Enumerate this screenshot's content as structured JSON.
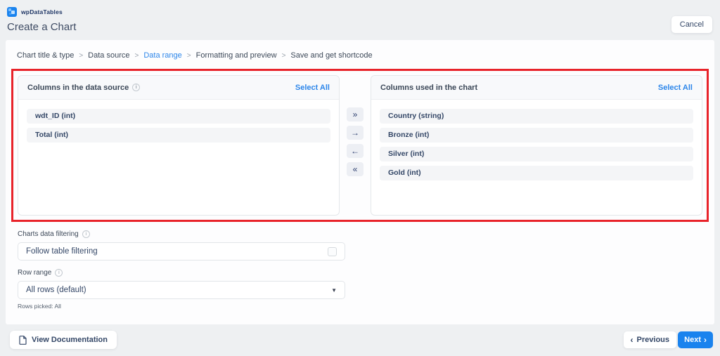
{
  "brand": {
    "name": "wpDataTables"
  },
  "page": {
    "title": "Create a Chart"
  },
  "header": {
    "cancel_label": "Cancel"
  },
  "breadcrumb": {
    "separator": ">",
    "steps": [
      {
        "label": "Chart title & type",
        "active": false
      },
      {
        "label": "Data source",
        "active": false
      },
      {
        "label": "Data range",
        "active": true
      },
      {
        "label": "Formatting and preview",
        "active": false
      },
      {
        "label": "Save and get shortcode",
        "active": false
      }
    ]
  },
  "columns_transfer": {
    "source_panel": {
      "title": "Columns in the data source",
      "select_all_label": "Select All",
      "items": [
        {
          "label": "wdt_ID (int)"
        },
        {
          "label": "Total (int)"
        }
      ]
    },
    "chart_panel": {
      "title": "Columns used in the chart",
      "select_all_label": "Select All",
      "items": [
        {
          "label": "Country (string)"
        },
        {
          "label": "Bronze (int)"
        },
        {
          "label": "Silver (int)"
        },
        {
          "label": "Gold (int)"
        }
      ]
    },
    "controls": {
      "move_all_right_glyph": "»",
      "move_right_glyph": "→",
      "move_left_glyph": "←",
      "move_all_left_glyph": "«"
    }
  },
  "filtering": {
    "label": "Charts data filtering",
    "option_label": "Follow table filtering",
    "checked": false
  },
  "row_range": {
    "label": "Row range",
    "selected_option": "All rows (default)",
    "caret_glyph": "▼",
    "summary": "Rows picked: All"
  },
  "footer": {
    "view_documentation_label": "View Documentation",
    "previous_label": "Previous",
    "previous_chevron": "‹",
    "next_label": "Next",
    "next_chevron": "›"
  },
  "icons": {
    "info_glyph": "i"
  },
  "colors": {
    "accent_blue": "#1a83ee",
    "link_blue": "#2d86ea",
    "highlight_red": "#e8232a",
    "navy_text": "#344767"
  }
}
